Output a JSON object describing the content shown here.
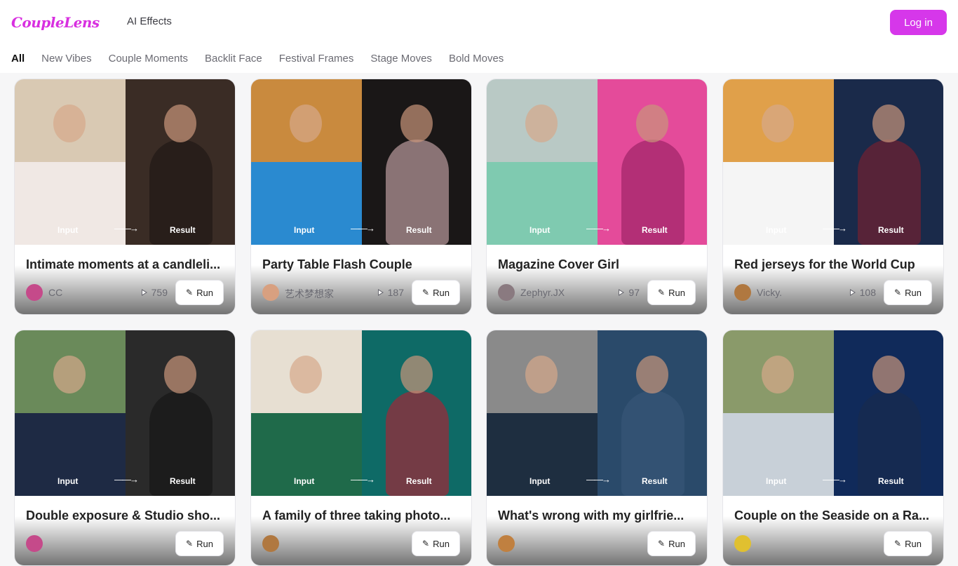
{
  "header": {
    "logo": "CoupleLens",
    "nav_ai_effects": "AI Effects",
    "login_label": "Log in"
  },
  "tabs": [
    {
      "label": "All",
      "active": true
    },
    {
      "label": "New Vibes"
    },
    {
      "label": "Couple Moments"
    },
    {
      "label": "Backlit Face"
    },
    {
      "label": "Festival Frames"
    },
    {
      "label": "Stage Moves"
    },
    {
      "label": "Bold Moves"
    }
  ],
  "card_labels": {
    "input": "Input",
    "result": "Result",
    "arrow": "——→",
    "run": "Run",
    "wand_icon": "✎"
  },
  "cards": [
    {
      "title": "Intimate moments at a candleli...",
      "author": "CC",
      "count": "759",
      "colors": [
        "#d9c9b3",
        "#3a2c25",
        "#f0e8e4",
        "#1a1412"
      ],
      "avatar": "#c54a8a"
    },
    {
      "title": "Party Table Flash Couple",
      "author": "艺术梦想家",
      "count": "187",
      "colors": [
        "#c98a3e",
        "#1a1717",
        "#2a8ad0",
        "#e8bfc3"
      ],
      "avatar": "#d8a080"
    },
    {
      "title": "Magazine Cover Girl",
      "author": "Zephyr.JX",
      "count": "97",
      "colors": [
        "#b9c9c5",
        "#e44b9a",
        "#7fcab0",
        "#8a1a5a"
      ],
      "avatar": "#8a7a80"
    },
    {
      "title": "Red jerseys for the World Cup",
      "author": "Vicky.",
      "count": "108",
      "colors": [
        "#e0a04a",
        "#1a2a4a",
        "#f5f5f5",
        "#8b1e2a"
      ],
      "avatar": "#b07840"
    },
    {
      "title": "Double exposure & Studio sho...",
      "author": "",
      "count": "",
      "colors": [
        "#6a8a5a",
        "#2a2a2a",
        "#1e2a44",
        "#101010"
      ],
      "avatar": "#c54a8a"
    },
    {
      "title": "A family of three taking photo...",
      "author": "",
      "count": "",
      "colors": [
        "#e7dfd2",
        "#0e6a66",
        "#1f6a4a",
        "#c8142a"
      ],
      "avatar": "#b07840"
    },
    {
      "title": "What's wrong with my girlfrie...",
      "author": "",
      "count": "",
      "colors": [
        "#8a8a8a",
        "#2a4a6a",
        "#1e2e40",
        "#3a5a7a"
      ],
      "avatar": "#c08040"
    },
    {
      "title": "Couple on the Seaside on a Ra...",
      "author": "",
      "count": "",
      "colors": [
        "#8a9a6a",
        "#102a5a",
        "#c8d0d8",
        "#1a2a4a"
      ],
      "avatar": "#e0c030"
    }
  ]
}
